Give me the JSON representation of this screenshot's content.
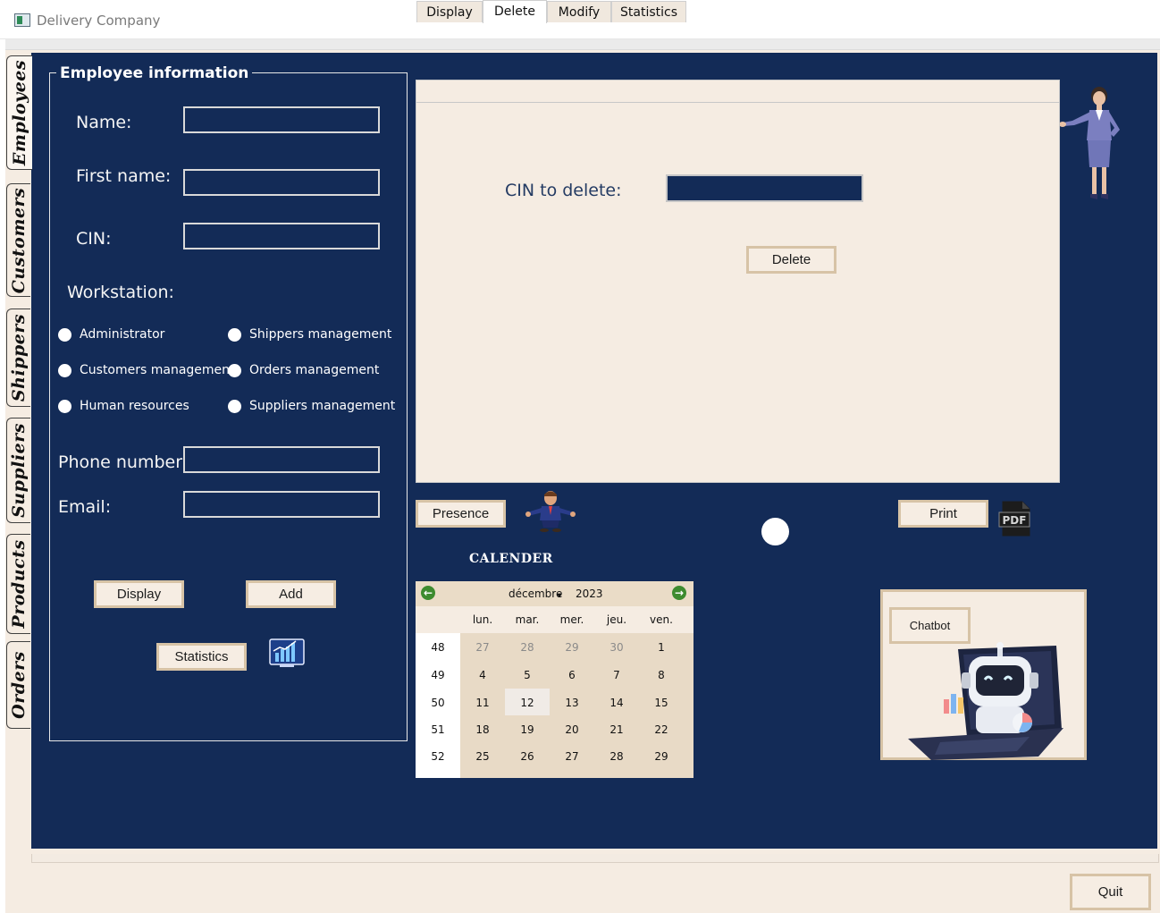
{
  "window": {
    "title": "Delivery Company"
  },
  "side_tabs": [
    "Employees",
    "Customers",
    "Shippers",
    "Suppliers",
    "Products",
    "Orders"
  ],
  "employee_form": {
    "group_title": "Employee information",
    "name_label": "Name:",
    "first_name_label": "First name:",
    "cin_label": "CIN:",
    "workstation_label": "Workstation:",
    "workstations": [
      "Administrator",
      "Shippers management",
      "Customers management",
      "Orders management",
      "Human resources",
      "Suppliers management"
    ],
    "phone_label": "Phone number:",
    "email_label": "Email:",
    "display_button": "Display",
    "add_button": "Add",
    "statistics_button": "Statistics"
  },
  "top_tabs": {
    "items": [
      "Display",
      "Delete",
      "Modify",
      "Statistics"
    ],
    "active": "Delete"
  },
  "delete_panel": {
    "cin_label": "CIN to delete:",
    "delete_button": "Delete"
  },
  "presence_button": "Presence",
  "print_button": "Print",
  "pdf_icon_text": "PDF",
  "calendar": {
    "title": "CALENDER",
    "month": "décembre",
    "year": "2023",
    "day_headers": [
      "lun.",
      "mar.",
      "mer.",
      "jeu.",
      "ven."
    ],
    "weeks": [
      {
        "num": "48",
        "days": [
          "27",
          "28",
          "29",
          "30",
          "1"
        ]
      },
      {
        "num": "49",
        "days": [
          "4",
          "5",
          "6",
          "7",
          "8"
        ]
      },
      {
        "num": "50",
        "days": [
          "11",
          "12",
          "13",
          "14",
          "15"
        ]
      },
      {
        "num": "51",
        "days": [
          "18",
          "19",
          "20",
          "21",
          "22"
        ]
      },
      {
        "num": "52",
        "days": [
          "25",
          "26",
          "27",
          "28",
          "29"
        ]
      }
    ],
    "selected": "12"
  },
  "chatbot_button": "Chatbot",
  "quit_button": "Quit",
  "colors": {
    "background": "#132b57",
    "panel": "#f5ece2",
    "button_border": "#d7c3a6"
  }
}
